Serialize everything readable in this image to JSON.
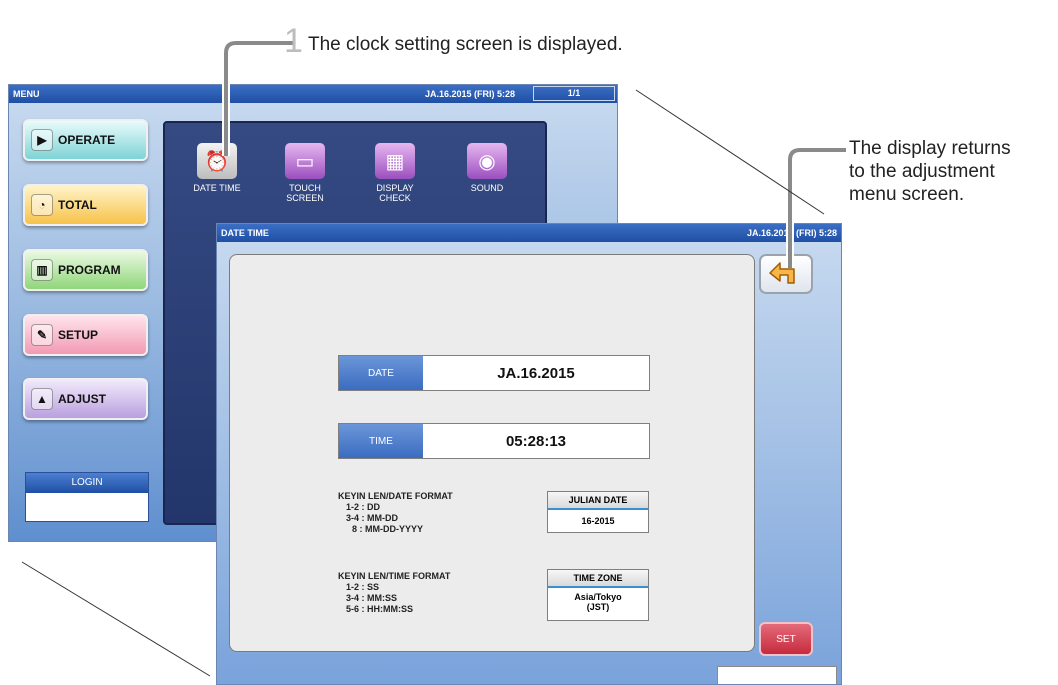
{
  "callouts": {
    "step_number": "1",
    "step_text": "The clock setting screen is displayed.",
    "right_text_line1": "The display returns",
    "right_text_line2": "to the adjustment",
    "right_text_line3": "menu screen."
  },
  "menu_screen": {
    "title": "MENU",
    "datetime": "JA.16.2015 (FRI)  5:28",
    "page_indicator": "1/1",
    "buttons": [
      {
        "label": "OPERATE",
        "icon": "play-icon"
      },
      {
        "label": "TOTAL",
        "icon": "clock-icon"
      },
      {
        "label": "PROGRAM",
        "icon": "book-icon"
      },
      {
        "label": "SETUP",
        "icon": "wrench-icon"
      },
      {
        "label": "ADJUST",
        "icon": "adjust-icon"
      }
    ],
    "login_label": "LOGIN",
    "icons": [
      {
        "label_line1": "DATE TIME",
        "label_line2": ""
      },
      {
        "label_line1": "TOUCH",
        "label_line2": "SCREEN"
      },
      {
        "label_line1": "DISPLAY",
        "label_line2": "CHECK"
      },
      {
        "label_line1": "SOUND",
        "label_line2": ""
      }
    ]
  },
  "datetime_screen": {
    "title": "DATE TIME",
    "datetime": "JA.16.2015 (FRI)  5:28",
    "date_label": "DATE",
    "date_value": "JA.16.2015",
    "time_label": "TIME",
    "time_value": "05:28:13",
    "date_format": {
      "heading": "KEYIN LEN/DATE FORMAT",
      "lines": [
        "1-2 : DD",
        "3-4 : MM-DD",
        "8 : MM-DD-YYYY"
      ]
    },
    "time_format": {
      "heading": "KEYIN LEN/TIME FORMAT",
      "lines": [
        "1-2 : SS",
        "3-4 : MM:SS",
        "5-6 : HH:MM:SS"
      ]
    },
    "julian_date": {
      "label": "JULIAN DATE",
      "value": "16-2015"
    },
    "time_zone": {
      "label": "TIME ZONE",
      "value_line1": "Asia/Tokyo",
      "value_line2": "(JST)"
    },
    "set_label": "SET"
  },
  "colors": {
    "titlebar": "#1f4fa4",
    "field_label": "#3b6cc0",
    "set_button": "#c52b3e",
    "icon_panel": "#23366b"
  }
}
